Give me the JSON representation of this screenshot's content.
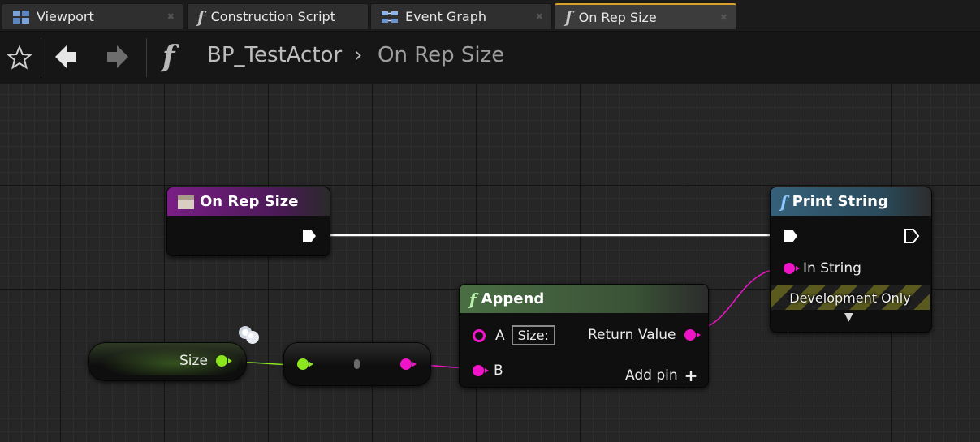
{
  "tabs": [
    {
      "label": "Viewport",
      "icon": "viewport-icon",
      "active": false
    },
    {
      "label": "Construction Script",
      "icon": "function-icon",
      "active": false
    },
    {
      "label": "Event Graph",
      "icon": "event-graph-icon",
      "active": false
    },
    {
      "label": "On Rep Size",
      "icon": "function-icon",
      "active": true
    }
  ],
  "toolbar": {
    "favorite_icon": "star-icon",
    "back_icon": "arrow-left-icon",
    "forward_icon": "arrow-right-icon",
    "function_glyph": "f",
    "breadcrumb_blueprint": "BP_TestActor",
    "breadcrumb_separator": "›",
    "breadcrumb_function": "On Rep Size"
  },
  "graph": {
    "nodes": {
      "on_rep_size": {
        "title": "On Rep Size",
        "header_color": "#7a1e86"
      },
      "size_var": {
        "label": "Size",
        "pin_color": "#8ce61e"
      },
      "conversion": {
        "label": ""
      },
      "append": {
        "title": "Append",
        "glyph": "f",
        "header_color": "#4a6e44",
        "pin_a_label": "A",
        "pin_a_value": "Size:",
        "pin_b_label": "B",
        "return_label": "Return Value",
        "add_pin_label": "Add pin",
        "add_pin_glyph": "+"
      },
      "print_string": {
        "title": "Print String",
        "glyph": "f",
        "header_color": "#36607a",
        "in_string_label": "In String",
        "dev_only_label": "Development Only",
        "expand_glyph": "▼"
      }
    },
    "colors": {
      "string_pin": "#f014c8",
      "int_pin": "#8ce61e",
      "exec_wire": "#ffffff"
    }
  }
}
